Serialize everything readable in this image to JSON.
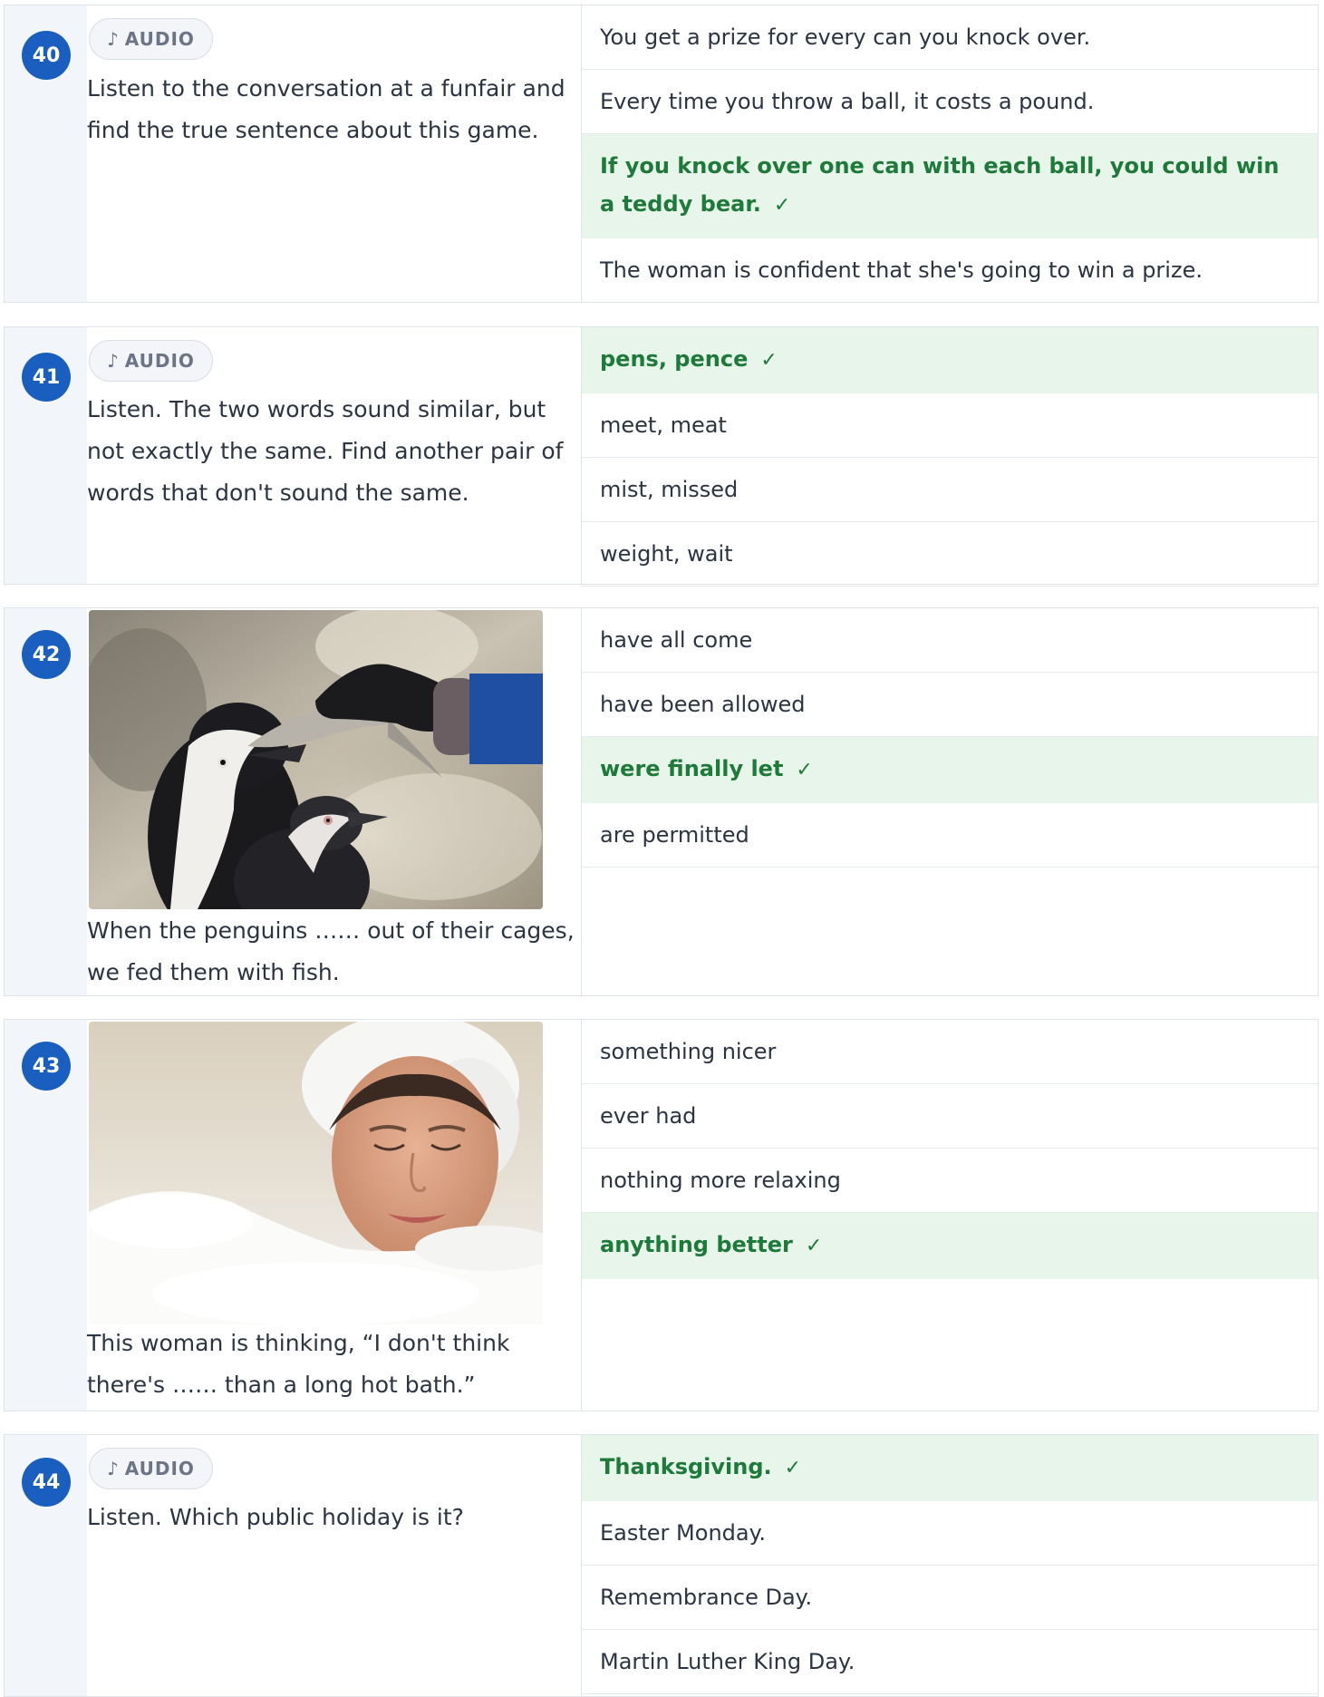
{
  "audio_label": "AUDIO",
  "questions": [
    {
      "number": "40",
      "prompt": "Listen to the conversation at a funfair and find the true sentence about this game.",
      "options": [
        {
          "text": "You get a prize for every can you knock over.",
          "correct": false
        },
        {
          "text": "Every time you throw a ball, it costs a pound.",
          "correct": false
        },
        {
          "text": "If you knock over one can with each ball, you could win a teddy bear.",
          "correct": true
        },
        {
          "text": "The woman is confident that she's going to win a prize.",
          "correct": false
        }
      ]
    },
    {
      "number": "41",
      "prompt": "Listen. The two words sound similar, but not exactly the same. Find another pair of words that don't sound the same.",
      "options": [
        {
          "text": "pens, pence",
          "correct": true
        },
        {
          "text": "meet, meat",
          "correct": false
        },
        {
          "text": "mist, missed",
          "correct": false
        },
        {
          "text": "weight, wait",
          "correct": false
        }
      ]
    },
    {
      "number": "42",
      "prompt": "When the penguins …… out of their cages, we fed them with fish.",
      "options": [
        {
          "text": "have all come",
          "correct": false
        },
        {
          "text": "have been allowed",
          "correct": false
        },
        {
          "text": "were finally let",
          "correct": true
        },
        {
          "text": "are permitted",
          "correct": false
        }
      ]
    },
    {
      "number": "43",
      "prompt": "This woman is thinking, “I don't think there's …… than a long hot bath.”",
      "options": [
        {
          "text": "something nicer",
          "correct": false
        },
        {
          "text": "ever had",
          "correct": false
        },
        {
          "text": "nothing more relaxing",
          "correct": false
        },
        {
          "text": "anything better",
          "correct": true
        }
      ]
    },
    {
      "number": "44",
      "prompt": "Listen. Which public holiday is it?",
      "options": [
        {
          "text": "Thanksgiving.",
          "correct": true
        },
        {
          "text": "Easter Monday.",
          "correct": false
        },
        {
          "text": "Remembrance Day.",
          "correct": false
        },
        {
          "text": "Martin Luther King Day.",
          "correct": false
        }
      ]
    }
  ],
  "check_icon": "check-icon",
  "colors": {
    "badge": "#1a5fbf",
    "correct_bg": "#e8f5ea",
    "correct_text": "#1e7a3a"
  }
}
